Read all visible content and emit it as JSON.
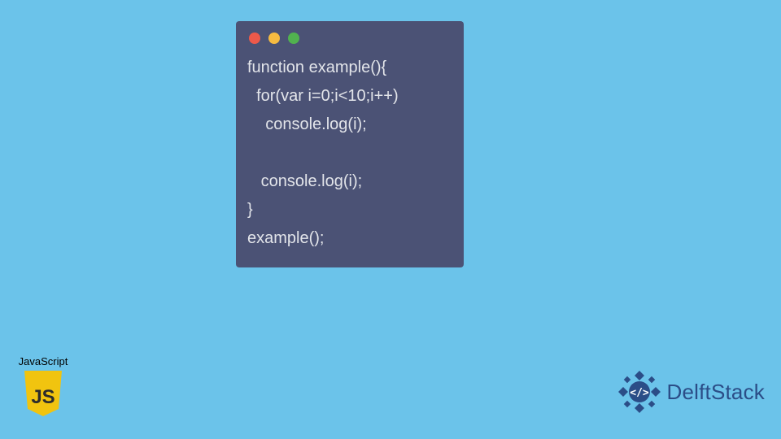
{
  "window": {
    "dots": {
      "red": "#ed594a",
      "yellow": "#f6bb41",
      "green": "#51b24f"
    }
  },
  "code": {
    "l1": "function example(){",
    "l2": "  for(var i=0;i<10;i++)",
    "l3": "    console.log(i);",
    "l4": "",
    "l5": "   console.log(i);",
    "l6": "}",
    "l7": "example();"
  },
  "badge": {
    "label": "JavaScript",
    "js_text": "JS"
  },
  "brand": {
    "name": "DelftStack"
  }
}
